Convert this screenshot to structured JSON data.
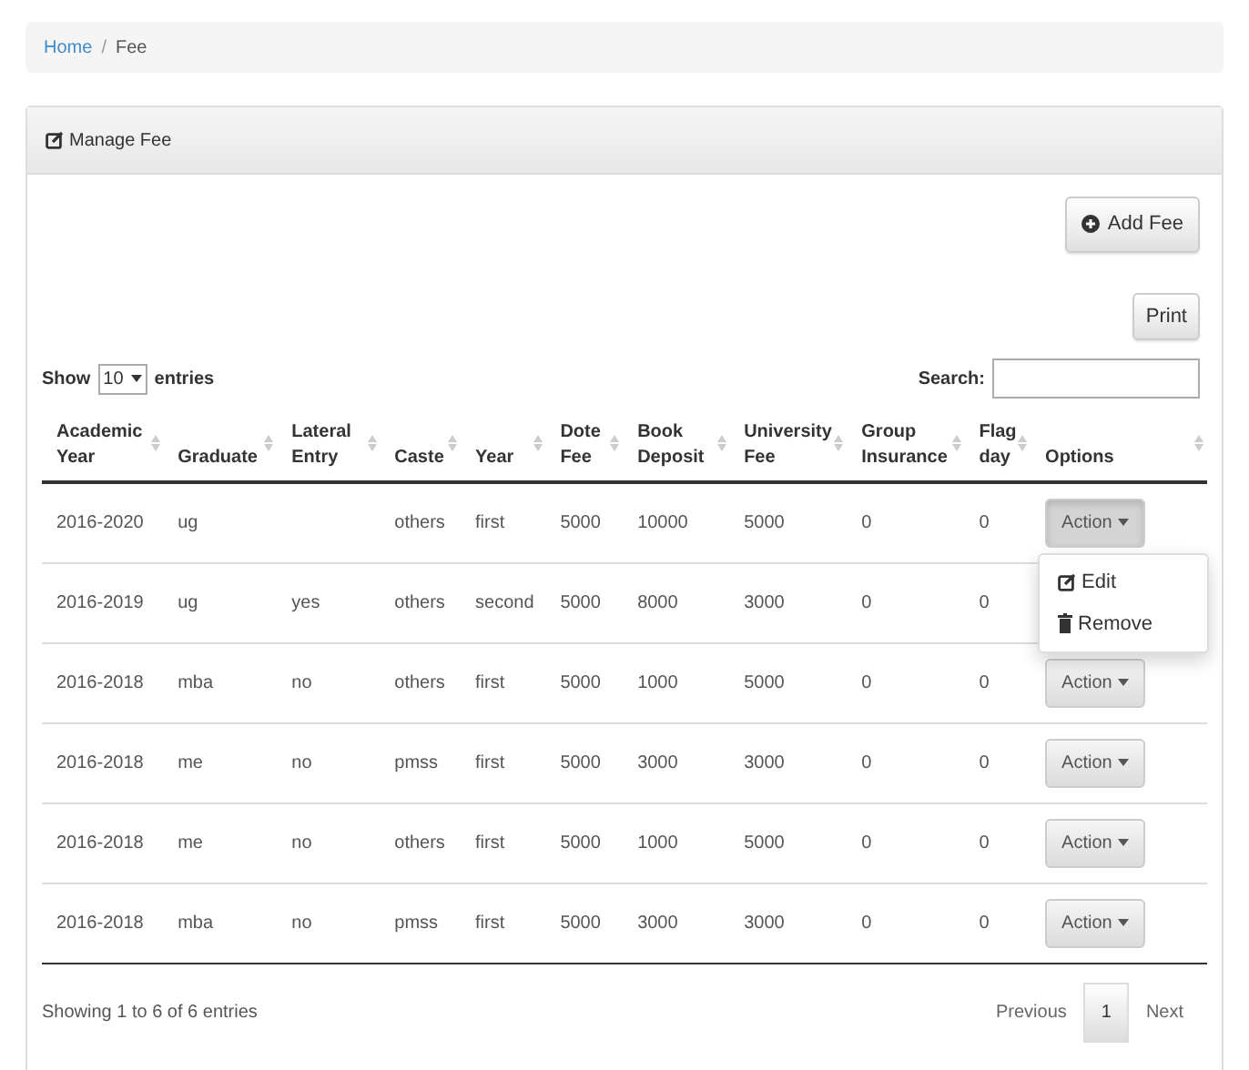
{
  "breadcrumb_separator": "/",
  "breadcrumb": [
    {
      "label": "Home",
      "active": false
    },
    {
      "label": "Fee",
      "active": true
    }
  ],
  "panel": {
    "title": "Manage Fee"
  },
  "add_button": "Add Fee",
  "print_button": "Print",
  "length": {
    "show": "Show",
    "value": "10",
    "entries": "entries"
  },
  "search": {
    "label": "Search:"
  },
  "table": {
    "columns": [
      "Academic Year",
      "Graduate",
      "Lateral Entry",
      "Caste",
      "Year",
      "Dote Fee",
      "Book Deposit",
      "University Fee",
      "Group Insurance",
      "Flag day",
      "Options"
    ],
    "rows": [
      {
        "cells": [
          "2016-2020",
          "ug",
          "",
          "others",
          "first",
          "5000",
          "10000",
          "5000",
          "0",
          "0"
        ],
        "action": "Action",
        "menu_open": true,
        "menu": [
          {
            "label": "Edit",
            "kind": "edit"
          },
          {
            "label": "Remove",
            "kind": "remove"
          }
        ]
      },
      {
        "cells": [
          "2016-2019",
          "ug",
          "yes",
          "others",
          "second",
          "5000",
          "8000",
          "3000",
          "0",
          "0"
        ]
      },
      {
        "cells": [
          "2016-2018",
          "mba",
          "no",
          "others",
          "first",
          "5000",
          "1000",
          "5000",
          "0",
          "0"
        ],
        "action": "Action",
        "menu_open": false
      },
      {
        "cells": [
          "2016-2018",
          "me",
          "no",
          "pmss",
          "first",
          "5000",
          "3000",
          "3000",
          "0",
          "0"
        ],
        "action": "Action",
        "menu_open": false
      },
      {
        "cells": [
          "2016-2018",
          "me",
          "no",
          "others",
          "first",
          "5000",
          "1000",
          "5000",
          "0",
          "0"
        ],
        "action": "Action",
        "menu_open": false
      },
      {
        "cells": [
          "2016-2018",
          "mba",
          "no",
          "pmss",
          "first",
          "5000",
          "3000",
          "3000",
          "0",
          "0"
        ],
        "action": "Action",
        "menu_open": false
      }
    ]
  },
  "info": "Showing 1 to 6 of 6 entries",
  "pagination": [
    {
      "label": "Previous",
      "selected": false
    },
    {
      "label": "1",
      "selected": true
    },
    {
      "label": "Next",
      "selected": false
    }
  ]
}
